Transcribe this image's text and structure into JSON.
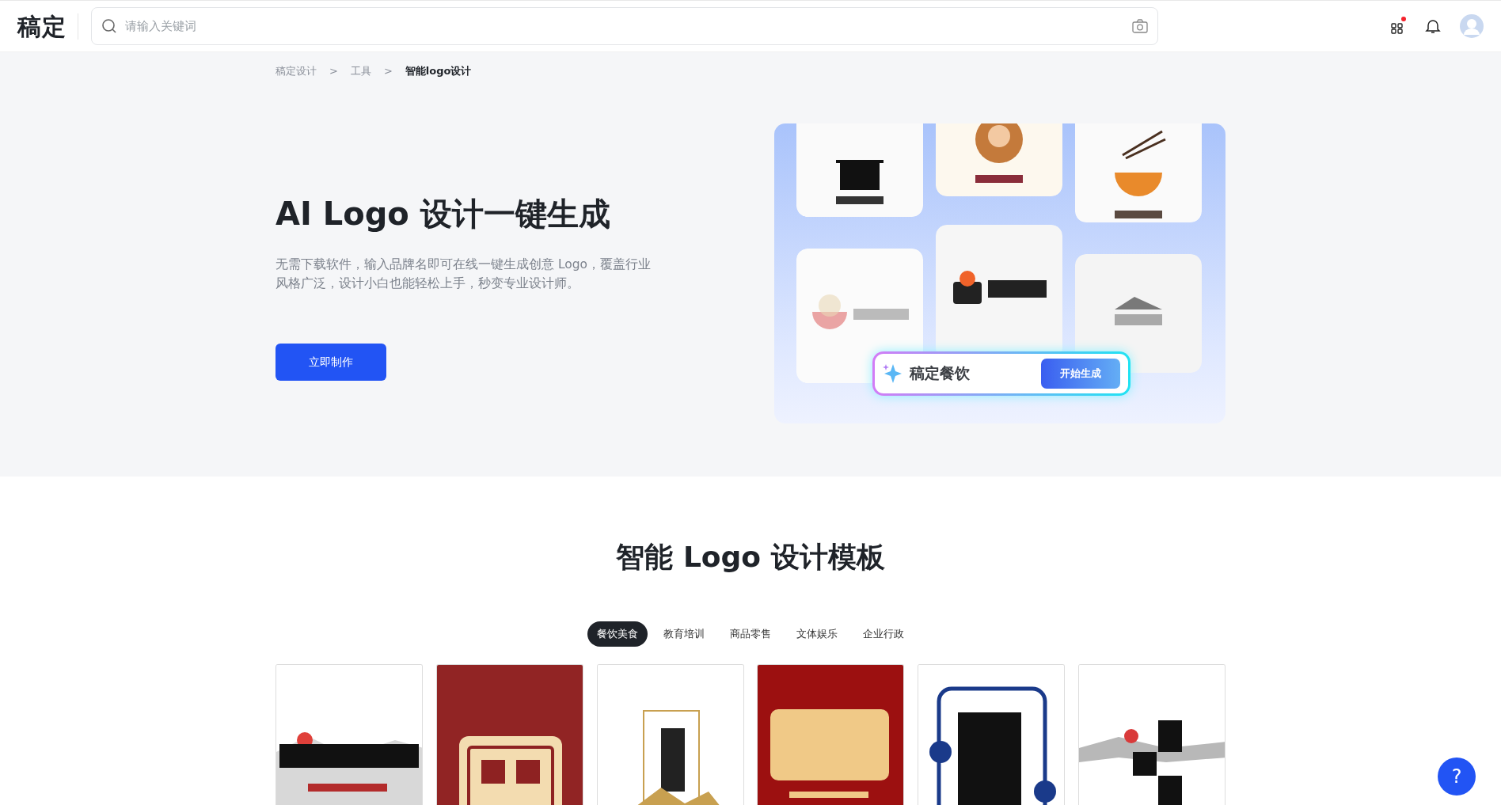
{
  "header": {
    "logo": "稿定",
    "search": {
      "placeholder": "请输入关键词"
    },
    "notification_dot": true
  },
  "breadcrumb": [
    {
      "label": "稿定设计",
      "current": false
    },
    {
      "label": "工具",
      "current": false
    },
    {
      "label": "智能logo设计",
      "current": true
    }
  ],
  "breadcrumb_separator": ">",
  "hero": {
    "title": "AI Logo 设计一键生成",
    "description": "无需下载软件，输入品牌名即可在线一键生成创意 Logo，覆盖行业风格广泛，设计小白也能轻松上手，秒变专业设计师。",
    "button": "立即制作",
    "demo": {
      "input_value": "稿定餐饮",
      "button": "开始生成"
    }
  },
  "templates": {
    "title": "智能 Logo 设计模板",
    "tabs": [
      {
        "label": "餐饮美食",
        "selected": true
      },
      {
        "label": "教育培训",
        "selected": false
      },
      {
        "label": "商品零售",
        "selected": false
      },
      {
        "label": "文体娱乐",
        "selected": false
      },
      {
        "label": "企业行政",
        "selected": false
      }
    ]
  },
  "help_button": "?"
}
